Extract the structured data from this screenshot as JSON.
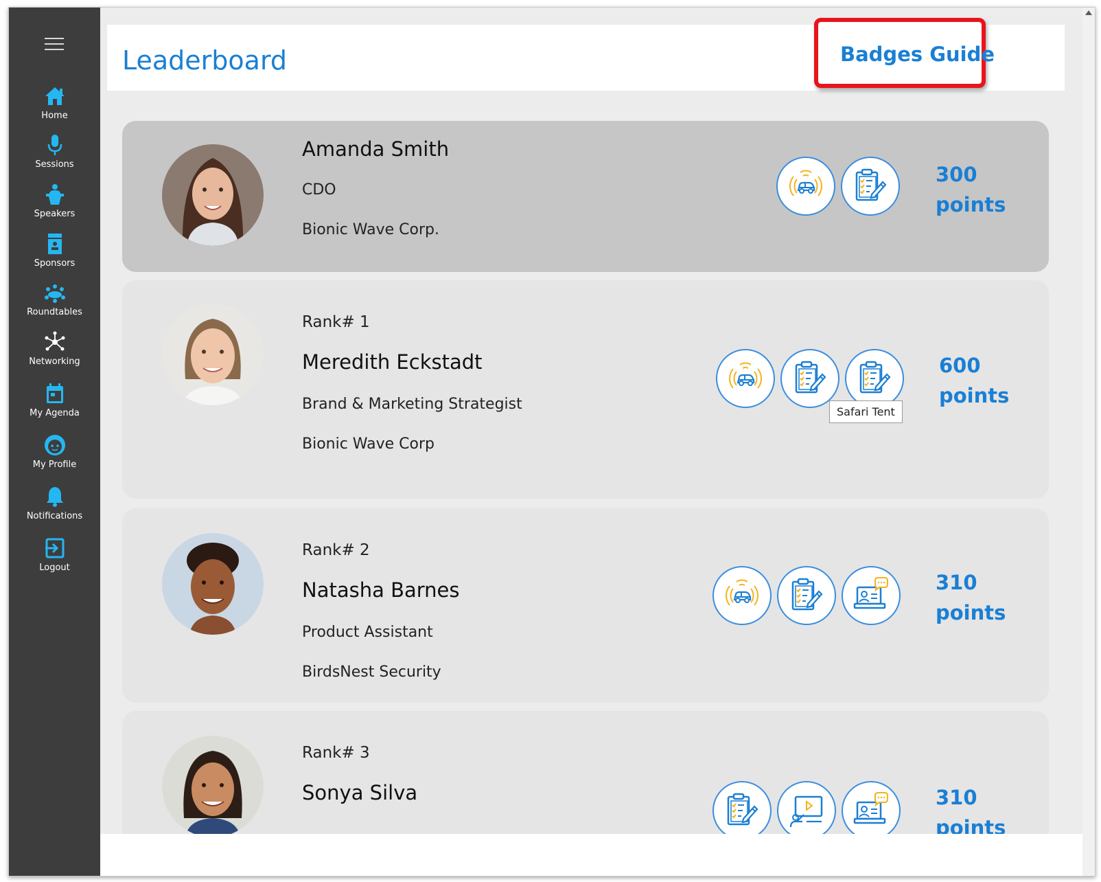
{
  "sidebar": {
    "items": [
      {
        "label": "Home",
        "icon": "home-icon"
      },
      {
        "label": "Sessions",
        "icon": "microphone-icon"
      },
      {
        "label": "Speakers",
        "icon": "speaker-podium-icon"
      },
      {
        "label": "Sponsors",
        "icon": "sponsor-booth-icon"
      },
      {
        "label": "Roundtables",
        "icon": "roundtable-icon"
      },
      {
        "label": "Networking",
        "icon": "network-icon"
      },
      {
        "label": "My Agenda",
        "icon": "calendar-icon"
      },
      {
        "label": "My Profile",
        "icon": "profile-face-icon"
      },
      {
        "label": "Notifications",
        "icon": "bell-icon"
      },
      {
        "label": "Logout",
        "icon": "logout-icon"
      }
    ]
  },
  "header": {
    "title": "Leaderboard",
    "badges_guide": "Badges Guide"
  },
  "colors": {
    "accent": "#1a7fd4",
    "sidebar": "#3d3d3d",
    "highlight_border": "#e8141c"
  },
  "entries": [
    {
      "rank": "",
      "name": "Amanda Smith",
      "title": "CDO",
      "company": "Bionic Wave Corp.",
      "points_value": "300",
      "points_unit": "points",
      "badges": [
        "car-badge-icon",
        "checklist-badge-icon"
      ]
    },
    {
      "rank": "Rank# 1",
      "name": "Meredith Eckstadt",
      "title": "Brand & Marketing Strategist",
      "company": "Bionic Wave Corp",
      "points_value": "600",
      "points_unit": "points",
      "badges": [
        "car-badge-icon",
        "checklist-badge-icon",
        "checklist-badge-icon"
      ],
      "tooltip": "Safari Tent"
    },
    {
      "rank": "Rank# 2",
      "name": "Natasha Barnes",
      "title": "Product Assistant",
      "company": "BirdsNest Security",
      "points_value": "310",
      "points_unit": "points",
      "badges": [
        "car-badge-icon",
        "checklist-badge-icon",
        "laptop-chat-badge-icon"
      ]
    },
    {
      "rank": "Rank# 3",
      "name": "Sonya Silva",
      "title": "",
      "company": "",
      "points_value": "310",
      "points_unit": "points",
      "badges": [
        "checklist-badge-icon",
        "presentation-badge-icon",
        "laptop-chat-badge-icon"
      ]
    }
  ]
}
